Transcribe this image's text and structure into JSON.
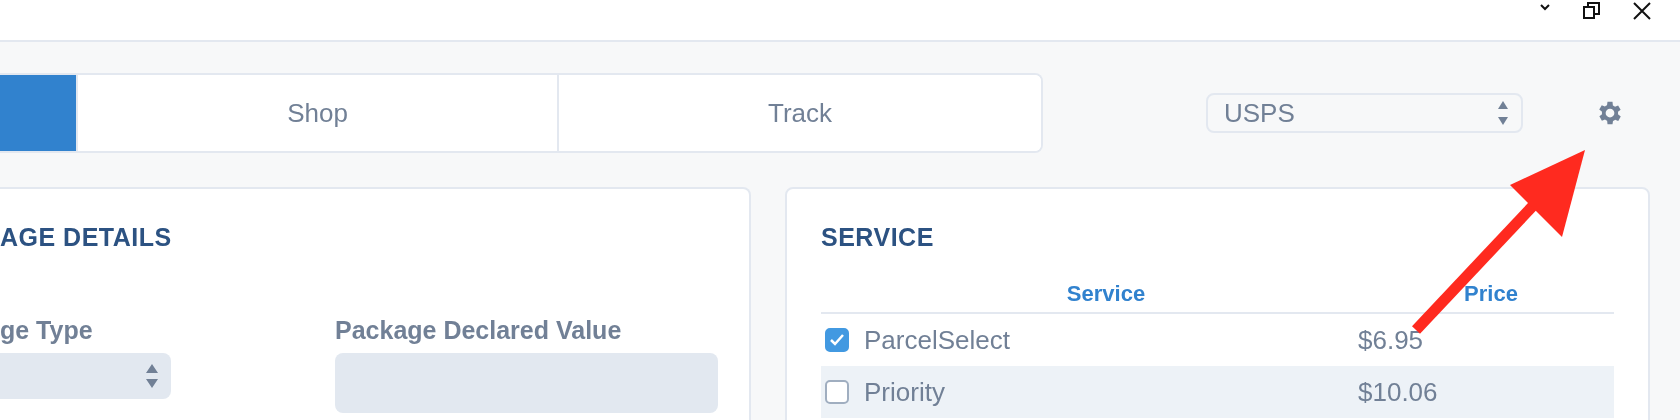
{
  "tabs": [
    {
      "selected": true
    },
    {
      "label": "Shop",
      "selected": false
    },
    {
      "label": "Track",
      "selected": false
    }
  ],
  "carrier_select": {
    "value": "USPS"
  },
  "package_details": {
    "title": "AGE DETAILS",
    "fields": [
      {
        "label": "ge Type",
        "kind": "select"
      },
      {
        "label": "Package Declared Value",
        "kind": "input"
      }
    ]
  },
  "service": {
    "title": "SERVICE",
    "columns": [
      "Service",
      "Price"
    ],
    "rows": [
      {
        "name": "ParcelSelect",
        "price": "$6.95",
        "checked": true,
        "selected": false
      },
      {
        "name": "Priority",
        "price": "$10.06",
        "checked": false,
        "selected": true
      }
    ]
  }
}
